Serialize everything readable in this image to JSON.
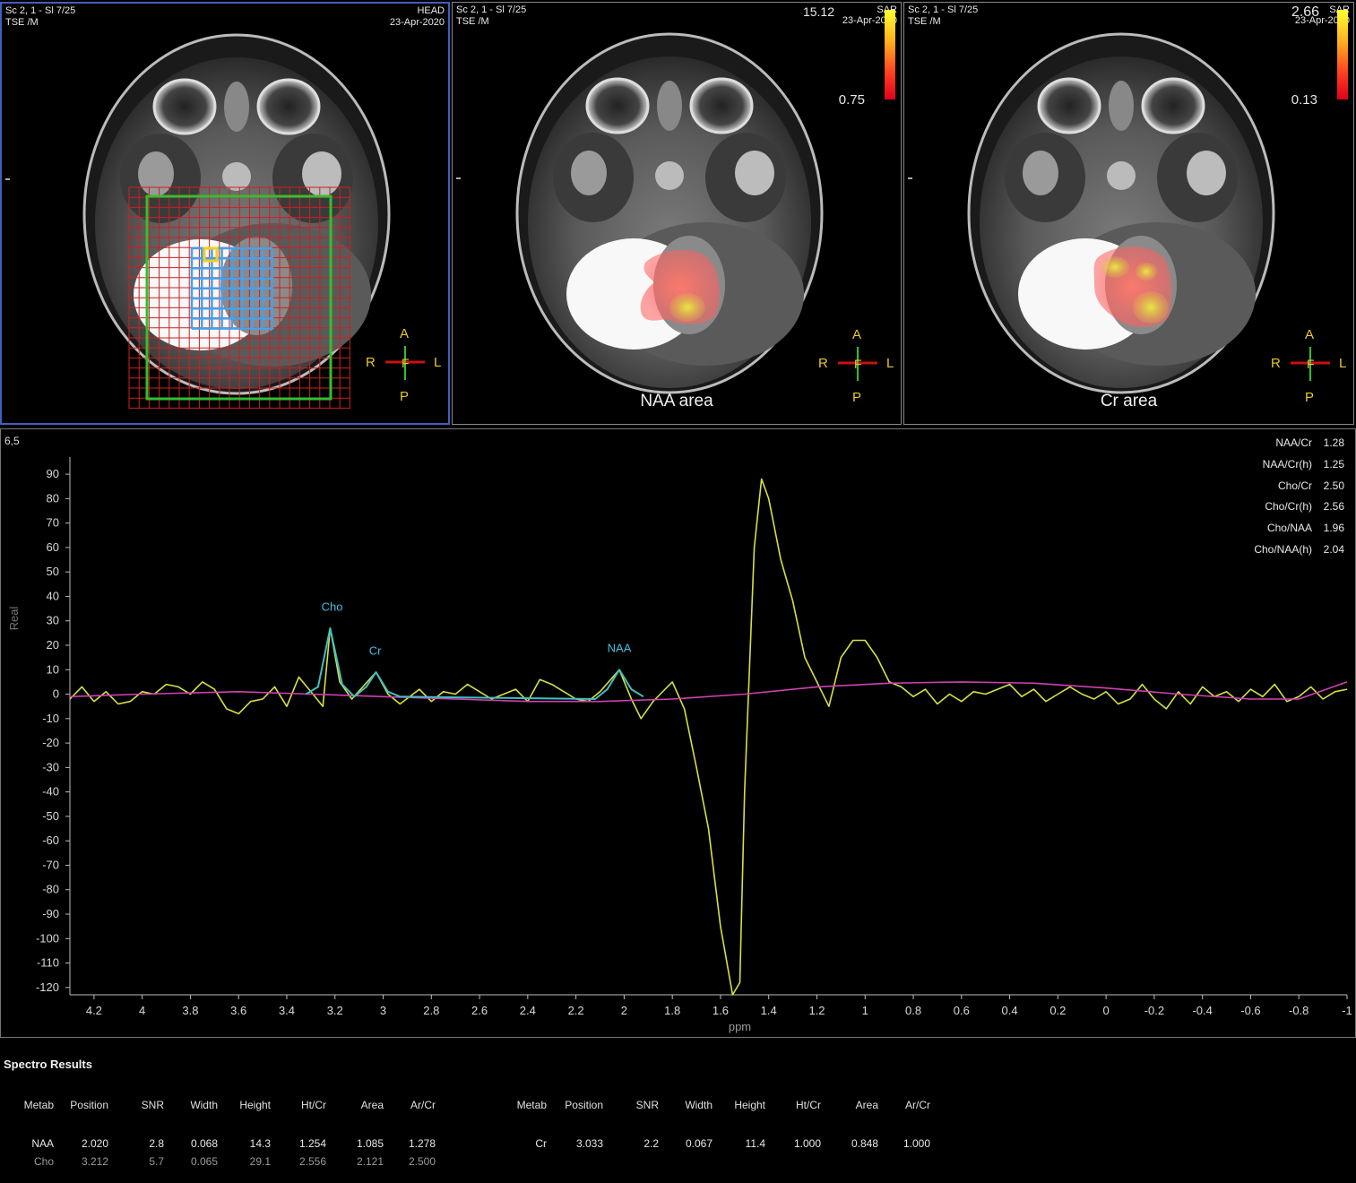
{
  "viewports": [
    {
      "series": "Sc 2, 1 - Sl 7/25",
      "sequence": "TSE  /M",
      "region": "HEAD",
      "date": "23-Apr-2020"
    },
    {
      "series": "Sc 2, 1 - Sl 7/25",
      "sequence": "TSE  /M",
      "date": "23-Apr-2020",
      "scale_label": "SAR",
      "scale_max": "15.12",
      "scale_min": "0.75",
      "map_label": "NAA area"
    },
    {
      "series": "Sc 2, 1 - Sl 7/25",
      "sequence": "TSE  /M",
      "date": "23-Apr-2020",
      "scale_label": "SAR",
      "scale_max": "2.66",
      "scale_min": "0.13",
      "map_label": "Cr area"
    }
  ],
  "orientation": {
    "anterior": "A",
    "posterior": "P",
    "right": "R",
    "left": "L",
    "foot": "F"
  },
  "colors": {
    "grid_red": "#cc2020",
    "grid_blue": "#4aa0e8",
    "voi_green": "#30c030",
    "spectrum_yellow": "#d8e040",
    "baseline_magenta": "#d040b0",
    "fit_cyan": "#40c0c0",
    "label_cyan": "#40c0e0",
    "orient_yellow": "#e8c82a",
    "orient_red": "#cc1010"
  },
  "spectrum": {
    "voxel": "6,5",
    "ratios": [
      {
        "label": "NAA/Cr",
        "value": "1.28"
      },
      {
        "label": "NAA/Cr(h)",
        "value": "1.25"
      },
      {
        "label": "Cho/Cr",
        "value": "2.50"
      },
      {
        "label": "Cho/Cr(h)",
        "value": "2.56"
      },
      {
        "label": "Cho/NAA",
        "value": "1.96"
      },
      {
        "label": "Cho/NAA(h)",
        "value": "2.04"
      }
    ]
  },
  "chart_data": {
    "type": "line",
    "xlabel": "ppm",
    "ylabel": "Real",
    "xlim": [
      4.3,
      -1.0
    ],
    "ylim": [
      -123,
      97
    ],
    "x_ticks": [
      "4.2",
      "4",
      "3.8",
      "3.6",
      "3.4",
      "3.2",
      "3",
      "2.8",
      "2.6",
      "2.4",
      "2.2",
      "2",
      "1.8",
      "1.6",
      "1.4",
      "1.2",
      "1",
      "0.8",
      "0.6",
      "0.4",
      "0.2",
      "0",
      "-0.2",
      "-0.4",
      "-0.6",
      "-0.8",
      "-1"
    ],
    "y_ticks": [
      "90",
      "80",
      "70",
      "60",
      "50",
      "40",
      "30",
      "20",
      "10",
      "0",
      "-10",
      "-20",
      "-30",
      "-40",
      "-50",
      "-60",
      "-70",
      "-80",
      "-90",
      "-100",
      "-110",
      "-120"
    ],
    "peak_labels": [
      {
        "text": "Cho",
        "x": 3.212,
        "y": 32
      },
      {
        "text": "Cr",
        "x": 3.033,
        "y": 14
      },
      {
        "text": "NAA",
        "x": 2.02,
        "y": 15
      }
    ],
    "series": [
      {
        "values": [
          [
            4.3,
            -2
          ],
          [
            4.25,
            3
          ],
          [
            4.2,
            -3
          ],
          [
            4.15,
            1
          ],
          [
            4.1,
            -4
          ],
          [
            4.05,
            -3
          ],
          [
            4.0,
            1
          ],
          [
            3.95,
            0
          ],
          [
            3.9,
            4
          ],
          [
            3.85,
            3
          ],
          [
            3.8,
            0
          ],
          [
            3.75,
            5
          ],
          [
            3.7,
            2
          ],
          [
            3.65,
            -6
          ],
          [
            3.6,
            -8
          ],
          [
            3.55,
            -3
          ],
          [
            3.5,
            -2
          ],
          [
            3.45,
            3
          ],
          [
            3.4,
            -5
          ],
          [
            3.35,
            7
          ],
          [
            3.3,
            1
          ],
          [
            3.25,
            -5
          ],
          [
            3.22,
            27
          ],
          [
            3.18,
            5
          ],
          [
            3.13,
            -2
          ],
          [
            3.03,
            9
          ],
          [
            2.98,
            0
          ],
          [
            2.93,
            -4
          ],
          [
            2.85,
            2
          ],
          [
            2.8,
            -3
          ],
          [
            2.75,
            1
          ],
          [
            2.7,
            0
          ],
          [
            2.65,
            4
          ],
          [
            2.6,
            1
          ],
          [
            2.55,
            -2
          ],
          [
            2.5,
            0
          ],
          [
            2.45,
            2
          ],
          [
            2.4,
            -3
          ],
          [
            2.35,
            6
          ],
          [
            2.3,
            4
          ],
          [
            2.25,
            1
          ],
          [
            2.2,
            -2
          ],
          [
            2.15,
            -3
          ],
          [
            2.1,
            1
          ],
          [
            2.02,
            10
          ],
          [
            1.97,
            -2
          ],
          [
            1.93,
            -10
          ],
          [
            1.88,
            -3
          ],
          [
            1.85,
            0
          ],
          [
            1.8,
            5
          ],
          [
            1.75,
            -6
          ],
          [
            1.7,
            -30
          ],
          [
            1.65,
            -55
          ],
          [
            1.6,
            -95
          ],
          [
            1.55,
            -123
          ],
          [
            1.52,
            -118
          ],
          [
            1.5,
            -40
          ],
          [
            1.46,
            60
          ],
          [
            1.43,
            88
          ],
          [
            1.4,
            80
          ],
          [
            1.35,
            55
          ],
          [
            1.3,
            38
          ],
          [
            1.25,
            15
          ],
          [
            1.2,
            5
          ],
          [
            1.15,
            -5
          ],
          [
            1.1,
            15
          ],
          [
            1.05,
            22
          ],
          [
            1.0,
            22
          ],
          [
            0.95,
            15
          ],
          [
            0.9,
            5
          ],
          [
            0.85,
            3
          ],
          [
            0.8,
            -1
          ],
          [
            0.75,
            2
          ],
          [
            0.7,
            -4
          ],
          [
            0.65,
            0
          ],
          [
            0.6,
            -3
          ],
          [
            0.55,
            1
          ],
          [
            0.5,
            0
          ],
          [
            0.45,
            2
          ],
          [
            0.4,
            4
          ],
          [
            0.35,
            -1
          ],
          [
            0.3,
            2
          ],
          [
            0.25,
            -3
          ],
          [
            0.2,
            0
          ],
          [
            0.15,
            3
          ],
          [
            0.1,
            0
          ],
          [
            0.05,
            -2
          ],
          [
            0.0,
            1
          ],
          [
            -0.05,
            -4
          ],
          [
            -0.1,
            -2
          ],
          [
            -0.15,
            4
          ],
          [
            -0.2,
            -2
          ],
          [
            -0.25,
            -6
          ],
          [
            -0.3,
            1
          ],
          [
            -0.35,
            -4
          ],
          [
            -0.4,
            3
          ],
          [
            -0.45,
            -1
          ],
          [
            -0.5,
            1
          ],
          [
            -0.55,
            -3
          ],
          [
            -0.6,
            2
          ],
          [
            -0.65,
            -1
          ],
          [
            -0.7,
            4
          ],
          [
            -0.75,
            -3
          ],
          [
            -0.8,
            -1
          ],
          [
            -0.85,
            3
          ],
          [
            -0.9,
            -2
          ],
          [
            -0.95,
            1
          ],
          [
            -1.0,
            2
          ]
        ]
      },
      {
        "values": [
          [
            4.3,
            -1
          ],
          [
            4.0,
            0
          ],
          [
            3.6,
            1
          ],
          [
            3.3,
            0
          ],
          [
            3.0,
            -1
          ],
          [
            2.7,
            -2
          ],
          [
            2.4,
            -3
          ],
          [
            2.1,
            -3
          ],
          [
            1.8,
            -2
          ],
          [
            1.5,
            0
          ],
          [
            1.2,
            3
          ],
          [
            0.9,
            4.5
          ],
          [
            0.6,
            5
          ],
          [
            0.3,
            4.5
          ],
          [
            0.0,
            2.5
          ],
          [
            -0.3,
            0
          ],
          [
            -0.6,
            -2
          ],
          [
            -0.8,
            -2
          ],
          [
            -1.0,
            5
          ]
        ]
      },
      {
        "values": [
          [
            3.32,
            0
          ],
          [
            3.27,
            3
          ],
          [
            3.22,
            27
          ],
          [
            3.17,
            4
          ],
          [
            3.12,
            -1
          ],
          [
            3.07,
            3
          ],
          [
            3.03,
            9
          ],
          [
            2.98,
            1
          ],
          [
            2.93,
            -1
          ],
          [
            2.12,
            -2
          ],
          [
            2.07,
            2
          ],
          [
            2.02,
            10
          ],
          [
            1.97,
            2
          ],
          [
            1.92,
            -1
          ]
        ]
      }
    ]
  },
  "results": {
    "title": "Spectro Results",
    "headers": [
      "Metab",
      "Position",
      "SNR",
      "Width",
      "Height",
      "Ht/Cr",
      "Area",
      "Ar/Cr"
    ],
    "left_rows": [
      [
        "NAA",
        "2.020",
        "2.8",
        "0.068",
        "14.3",
        "1.254",
        "1.085",
        "1.278"
      ],
      [
        "Cho",
        "3.212",
        "5.7",
        "0.065",
        "29.1",
        "2.556",
        "2.121",
        "2.500"
      ]
    ],
    "right_rows": [
      [
        "Cr",
        "3.033",
        "2.2",
        "0.067",
        "11.4",
        "1.000",
        "0.848",
        "1.000"
      ]
    ]
  }
}
